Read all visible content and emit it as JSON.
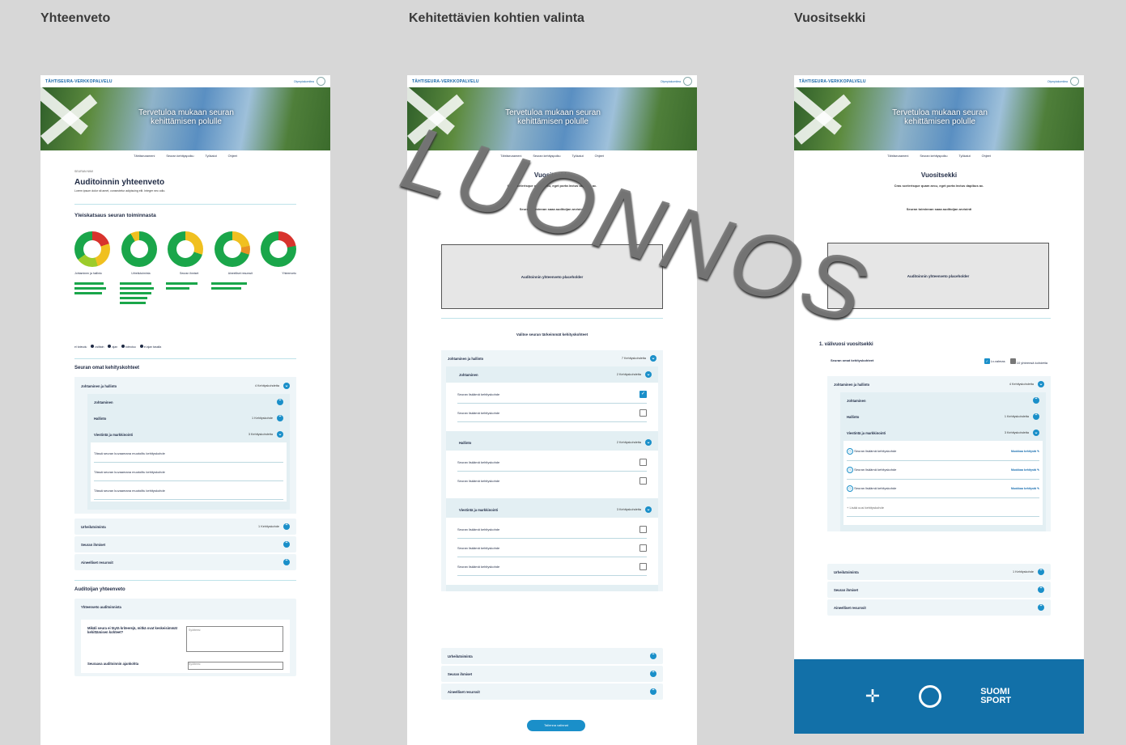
{
  "columns": {
    "c1": "Yhteenveto",
    "c2": "Kehitettävien kohtien valinta",
    "c3": "Vuositsekki"
  },
  "common": {
    "brand": "TÄHTISEURA-VERKKOPALVELU",
    "olympic_label": "Olympiakomitea",
    "hero_text": "Tervetuloa mukaan seuran kehittämisen polulle",
    "nav": [
      "Tähtiseurameni",
      "Seuran kehityspolku",
      "Työkalut",
      "Ohjeet"
    ]
  },
  "summary": {
    "kicker": "SEURAN NIMI",
    "title": "Auditoinnin yhteenveto",
    "lead": "Lorem ipsum dolor sit amet, consectetur adipiscing elit. Integer nec odio.",
    "overview_title": "Yleiskatsaus seuran toiminnasta",
    "categories": [
      "Johtaminen ja hallinto",
      "Urheilutoiminta",
      "Seuran ihmiset",
      "Aineelliset resurssit",
      "Yhteenveto"
    ],
    "legend": [
      "ei toteudu",
      "osittain",
      "ajan",
      "toteutuu",
      "ei ajan tasalla"
    ],
    "own_title": "Seuran omat kehityskohteet",
    "own_items": [
      {
        "label": "Johtaminen ja hallinto",
        "count": "4 Kehityskohdetta"
      },
      {
        "label": "Johtaminen",
        "count": ""
      },
      {
        "label": "Hallinto",
        "count": "1 Kehityskohde"
      },
      {
        "label": "Viestintä ja markkinointi",
        "count": "3 Kehityskohdetta"
      }
    ],
    "custom_items": [
      "Tässä seuran kuvaamana muotoiltu kehityskohde",
      "Tässä seuran kuvaamana muotoiltu kehityskohde",
      "Tässä seuran kuvaamana muotoiltu kehityskohde"
    ],
    "other_items": [
      {
        "label": "Urheilutoiminta",
        "count": "1 Kehityskohde"
      },
      {
        "label": "Seuran ihmiset",
        "count": ""
      },
      {
        "label": "Aineelliset resurssit",
        "count": ""
      }
    ],
    "auditor_title": "Auditoijan yhteenveto",
    "auditor_subtitle": "Yhteenveto auditoinnista",
    "auditor_q1": "Mikäli seura ei täytä kriteerejä, mitkä ovat keskeisimmät kehittämisen kohteet?",
    "auditor_q2": "Seuraava auditoinnin ajankohta",
    "field_placeholder": "Syötteesi"
  },
  "select": {
    "title": "Vuositsekki",
    "lead": "Cras scelerisque quam arcu, eget porta lectus dapibus ac.",
    "eval_label": "Seuran toiminnan saaa auditoijan arviointi",
    "placeholder": "Auditoinnin yhteenveto placeholder",
    "choose_label": "Valitse seuran tärkeimmät kehityskohteet",
    "groups": [
      {
        "label": "Johtaminen ja hallinto",
        "count": "7 Kehityskohdetta"
      },
      {
        "label": "Johtaminen",
        "count": "2 Kehityskohdetta"
      }
    ],
    "items_a": [
      {
        "label": "Seuran lisäämä kehityskohde",
        "checked": true
      },
      {
        "label": "Seuran lisäämä kehityskohde",
        "checked": false
      }
    ],
    "hallinto": {
      "label": "Hallinto",
      "count": "2 Kehityskohdetta"
    },
    "items_b": [
      "Seuran lisäämä kehityskohde",
      "Seuran lisäämä kehityskohde"
    ],
    "viestinta": {
      "label": "Viestintä ja markkinointi",
      "count": "3 Kehityskohdetta"
    },
    "items_c": [
      "Seuran lisäämä kehityskohde",
      "Seuran lisäämä kehityskohde",
      "Seuran lisäämä kehityskohde"
    ],
    "bottom_groups": [
      "Urheilutoiminta",
      "Seuran ihmiset",
      "Aineelliset resurssit"
    ],
    "save_label": "Tallenna valinnat"
  },
  "check": {
    "title": "Vuositsekki",
    "lead": "Cras scelerisque quam arcu, eget porta lectus dapibus ac.",
    "eval_label": "Seuran toiminnan saaa auditoijan arviointi",
    "placeholder": "Auditoinnin yhteenveto placeholder",
    "year_title": "1. välivuosi vuositsekki",
    "own_label": "Seuran omat kehityskohteet",
    "filter_done": "Lv.valmas",
    "filter_all": "10 yhteensä kohdetta",
    "groups": [
      {
        "label": "Johtaminen ja hallinto",
        "count": "4 Kehityskohdetta"
      },
      {
        "label": "Johtaminen",
        "count": ""
      },
      {
        "label": "Hallinto",
        "count": "1 Kehityskohdetta"
      },
      {
        "label": "Viestintä ja markkinointi",
        "count": "3 Kehityskohdetta"
      }
    ],
    "items": [
      "Seuran lisäämä kehityskohde",
      "Seuran lisäämä kehityskohde",
      "Seuran lisäämä kehityskohde"
    ],
    "edit_label": "Muokkaa kehitystä",
    "add_label": "Lisää uusi kehityskohde",
    "bottom": [
      {
        "label": "Urheilutoiminta",
        "count": "1 Kehityskohde"
      },
      {
        "label": "Seuran ihmiset",
        "count": ""
      },
      {
        "label": "Aineelliset resurssit",
        "count": ""
      }
    ],
    "footer_brand": "SUOMI SPORT"
  },
  "watermark": "LUONNOS"
}
